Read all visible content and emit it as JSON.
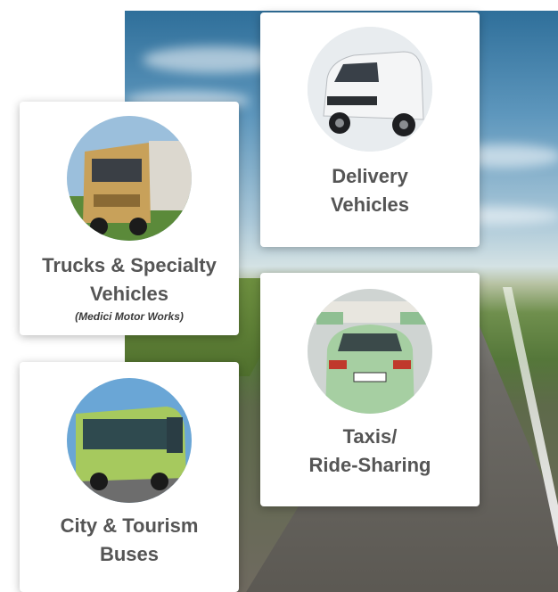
{
  "cards": [
    {
      "title": "Delivery",
      "title2": "Vehicles",
      "image": "delivery-van-photo"
    },
    {
      "title": "Trucks & Specialty",
      "title2": "Vehicles",
      "subtitle": "(Medici Motor Works)",
      "image": "truck-photo"
    },
    {
      "title": "Taxis/",
      "title2": "Ride-Sharing",
      "image": "taxi-photo"
    },
    {
      "title": "City & Tourism",
      "title2": "Buses",
      "image": "bus-photo"
    }
  ],
  "colors": {
    "card_text": "#555555",
    "card_bg": "#ffffff"
  }
}
